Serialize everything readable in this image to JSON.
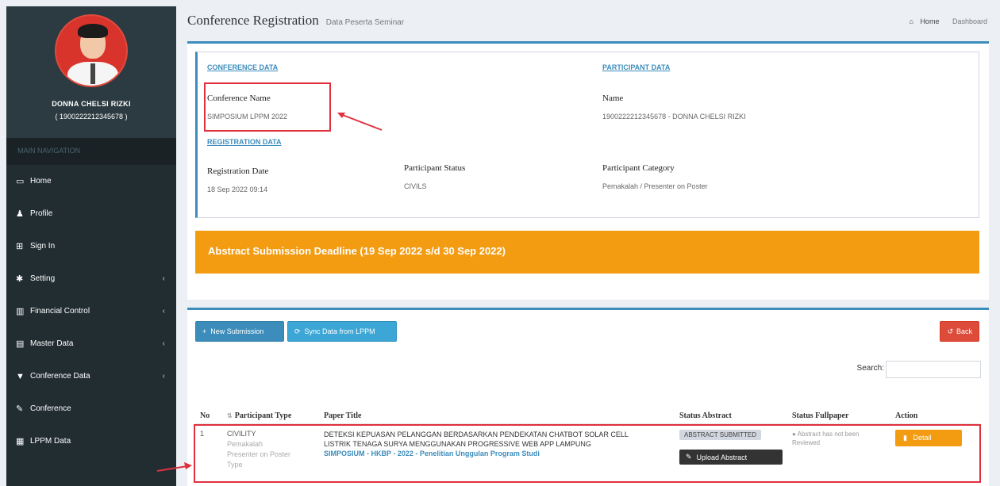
{
  "sidebar": {
    "user_name": "DONNA CHELSI RIZKI",
    "user_id": "( 1900222212345678 )",
    "nav_header": "MAIN NAVIGATION",
    "items": [
      {
        "icon": "▭",
        "label": "Home",
        "chev": ""
      },
      {
        "icon": "♟",
        "label": "Profile",
        "chev": ""
      },
      {
        "icon": "⊞",
        "label": "Sign In",
        "chev": ""
      },
      {
        "icon": "✱",
        "label": "Setting",
        "chev": "‹"
      },
      {
        "icon": "▥",
        "label": "Financial Control",
        "chev": "‹"
      },
      {
        "icon": "▤",
        "label": "Master Data",
        "chev": "‹"
      },
      {
        "icon": "▼",
        "label": "Conference Data",
        "chev": "‹"
      },
      {
        "icon": "✎",
        "label": "Conference",
        "chev": ""
      },
      {
        "icon": "▦",
        "label": "LPPM Data",
        "chev": ""
      }
    ]
  },
  "header": {
    "title": "Conference Registration",
    "subtitle": "Data Peserta Seminar",
    "breadcrumb_home": "Home",
    "breadcrumb_active": "Dashboard"
  },
  "conference": {
    "section_title": "CONFERENCE DATA",
    "name_label": "Conference Name",
    "name_value": "SIMPOSIUM LPPM 2022"
  },
  "participant": {
    "section_title": "PARTICIPANT DATA",
    "name_label": "Name",
    "name_value": "1900222212345678 - DONNA CHELSI RIZKI"
  },
  "registration": {
    "section_title": "REGISTRATION DATA",
    "date_label": "Registration Date",
    "date_value": "18 Sep 2022 09:14",
    "status_label": "Participant Status",
    "status_value": "CIVILS",
    "category_label": "Participant Category",
    "category_value": "Pemakalah / Presenter on Poster"
  },
  "deadline": {
    "text": "Abstract Submission Deadline (19 Sep 2022 s/d 30 Sep 2022)"
  },
  "toolbar": {
    "new_submission": "New Submission",
    "sync_lppm": "Sync Data from LPPM",
    "back": "Back",
    "search_label": "Search:"
  },
  "table": {
    "headers": [
      "No",
      "Participant Type",
      "Paper Title",
      "Status Abstract",
      "Status Fullpaper",
      "Action"
    ],
    "rows": [
      {
        "no": "1",
        "type_main": "CIVILITY",
        "type_sub1": "Pemakalah",
        "type_sub2": "Presenter on Poster",
        "type_sub3": "Type",
        "title_line1": "DETEKSI KEPUASAN PELANGGAN BERDASARKAN PENDEKATAN CHATBOT SOLAR CELL",
        "title_line2": "LISTRIK TENAGA SURYA MENGGUNAKAN PROGRESSIVE WEB APP LAMPUNG",
        "conf_tag": "SIMPOSIUM - HKBP - 2022 - Penelitian Unggulan Program Studi",
        "status_abstract": "ABSTRACT SUBMITTED",
        "upload_label": "Upload Abstract",
        "status_fullpaper": "Abstract has not been Reviewed",
        "action_label": "Detail"
      }
    ]
  }
}
